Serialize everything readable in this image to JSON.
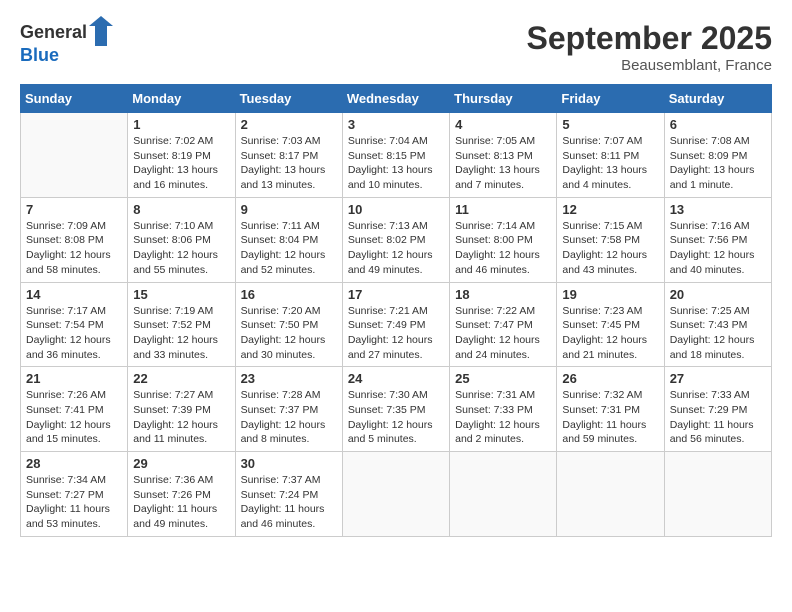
{
  "logo": {
    "general": "General",
    "blue": "Blue"
  },
  "header": {
    "month": "September 2025",
    "location": "Beausemblant, France"
  },
  "weekdays": [
    "Sunday",
    "Monday",
    "Tuesday",
    "Wednesday",
    "Thursday",
    "Friday",
    "Saturday"
  ],
  "weeks": [
    [
      {
        "day": "",
        "sunrise": "",
        "sunset": "",
        "daylight": ""
      },
      {
        "day": "1",
        "sunrise": "Sunrise: 7:02 AM",
        "sunset": "Sunset: 8:19 PM",
        "daylight": "Daylight: 13 hours and 16 minutes."
      },
      {
        "day": "2",
        "sunrise": "Sunrise: 7:03 AM",
        "sunset": "Sunset: 8:17 PM",
        "daylight": "Daylight: 13 hours and 13 minutes."
      },
      {
        "day": "3",
        "sunrise": "Sunrise: 7:04 AM",
        "sunset": "Sunset: 8:15 PM",
        "daylight": "Daylight: 13 hours and 10 minutes."
      },
      {
        "day": "4",
        "sunrise": "Sunrise: 7:05 AM",
        "sunset": "Sunset: 8:13 PM",
        "daylight": "Daylight: 13 hours and 7 minutes."
      },
      {
        "day": "5",
        "sunrise": "Sunrise: 7:07 AM",
        "sunset": "Sunset: 8:11 PM",
        "daylight": "Daylight: 13 hours and 4 minutes."
      },
      {
        "day": "6",
        "sunrise": "Sunrise: 7:08 AM",
        "sunset": "Sunset: 8:09 PM",
        "daylight": "Daylight: 13 hours and 1 minute."
      }
    ],
    [
      {
        "day": "7",
        "sunrise": "Sunrise: 7:09 AM",
        "sunset": "Sunset: 8:08 PM",
        "daylight": "Daylight: 12 hours and 58 minutes."
      },
      {
        "day": "8",
        "sunrise": "Sunrise: 7:10 AM",
        "sunset": "Sunset: 8:06 PM",
        "daylight": "Daylight: 12 hours and 55 minutes."
      },
      {
        "day": "9",
        "sunrise": "Sunrise: 7:11 AM",
        "sunset": "Sunset: 8:04 PM",
        "daylight": "Daylight: 12 hours and 52 minutes."
      },
      {
        "day": "10",
        "sunrise": "Sunrise: 7:13 AM",
        "sunset": "Sunset: 8:02 PM",
        "daylight": "Daylight: 12 hours and 49 minutes."
      },
      {
        "day": "11",
        "sunrise": "Sunrise: 7:14 AM",
        "sunset": "Sunset: 8:00 PM",
        "daylight": "Daylight: 12 hours and 46 minutes."
      },
      {
        "day": "12",
        "sunrise": "Sunrise: 7:15 AM",
        "sunset": "Sunset: 7:58 PM",
        "daylight": "Daylight: 12 hours and 43 minutes."
      },
      {
        "day": "13",
        "sunrise": "Sunrise: 7:16 AM",
        "sunset": "Sunset: 7:56 PM",
        "daylight": "Daylight: 12 hours and 40 minutes."
      }
    ],
    [
      {
        "day": "14",
        "sunrise": "Sunrise: 7:17 AM",
        "sunset": "Sunset: 7:54 PM",
        "daylight": "Daylight: 12 hours and 36 minutes."
      },
      {
        "day": "15",
        "sunrise": "Sunrise: 7:19 AM",
        "sunset": "Sunset: 7:52 PM",
        "daylight": "Daylight: 12 hours and 33 minutes."
      },
      {
        "day": "16",
        "sunrise": "Sunrise: 7:20 AM",
        "sunset": "Sunset: 7:50 PM",
        "daylight": "Daylight: 12 hours and 30 minutes."
      },
      {
        "day": "17",
        "sunrise": "Sunrise: 7:21 AM",
        "sunset": "Sunset: 7:49 PM",
        "daylight": "Daylight: 12 hours and 27 minutes."
      },
      {
        "day": "18",
        "sunrise": "Sunrise: 7:22 AM",
        "sunset": "Sunset: 7:47 PM",
        "daylight": "Daylight: 12 hours and 24 minutes."
      },
      {
        "day": "19",
        "sunrise": "Sunrise: 7:23 AM",
        "sunset": "Sunset: 7:45 PM",
        "daylight": "Daylight: 12 hours and 21 minutes."
      },
      {
        "day": "20",
        "sunrise": "Sunrise: 7:25 AM",
        "sunset": "Sunset: 7:43 PM",
        "daylight": "Daylight: 12 hours and 18 minutes."
      }
    ],
    [
      {
        "day": "21",
        "sunrise": "Sunrise: 7:26 AM",
        "sunset": "Sunset: 7:41 PM",
        "daylight": "Daylight: 12 hours and 15 minutes."
      },
      {
        "day": "22",
        "sunrise": "Sunrise: 7:27 AM",
        "sunset": "Sunset: 7:39 PM",
        "daylight": "Daylight: 12 hours and 11 minutes."
      },
      {
        "day": "23",
        "sunrise": "Sunrise: 7:28 AM",
        "sunset": "Sunset: 7:37 PM",
        "daylight": "Daylight: 12 hours and 8 minutes."
      },
      {
        "day": "24",
        "sunrise": "Sunrise: 7:30 AM",
        "sunset": "Sunset: 7:35 PM",
        "daylight": "Daylight: 12 hours and 5 minutes."
      },
      {
        "day": "25",
        "sunrise": "Sunrise: 7:31 AM",
        "sunset": "Sunset: 7:33 PM",
        "daylight": "Daylight: 12 hours and 2 minutes."
      },
      {
        "day": "26",
        "sunrise": "Sunrise: 7:32 AM",
        "sunset": "Sunset: 7:31 PM",
        "daylight": "Daylight: 11 hours and 59 minutes."
      },
      {
        "day": "27",
        "sunrise": "Sunrise: 7:33 AM",
        "sunset": "Sunset: 7:29 PM",
        "daylight": "Daylight: 11 hours and 56 minutes."
      }
    ],
    [
      {
        "day": "28",
        "sunrise": "Sunrise: 7:34 AM",
        "sunset": "Sunset: 7:27 PM",
        "daylight": "Daylight: 11 hours and 53 minutes."
      },
      {
        "day": "29",
        "sunrise": "Sunrise: 7:36 AM",
        "sunset": "Sunset: 7:26 PM",
        "daylight": "Daylight: 11 hours and 49 minutes."
      },
      {
        "day": "30",
        "sunrise": "Sunrise: 7:37 AM",
        "sunset": "Sunset: 7:24 PM",
        "daylight": "Daylight: 11 hours and 46 minutes."
      },
      {
        "day": "",
        "sunrise": "",
        "sunset": "",
        "daylight": ""
      },
      {
        "day": "",
        "sunrise": "",
        "sunset": "",
        "daylight": ""
      },
      {
        "day": "",
        "sunrise": "",
        "sunset": "",
        "daylight": ""
      },
      {
        "day": "",
        "sunrise": "",
        "sunset": "",
        "daylight": ""
      }
    ]
  ]
}
